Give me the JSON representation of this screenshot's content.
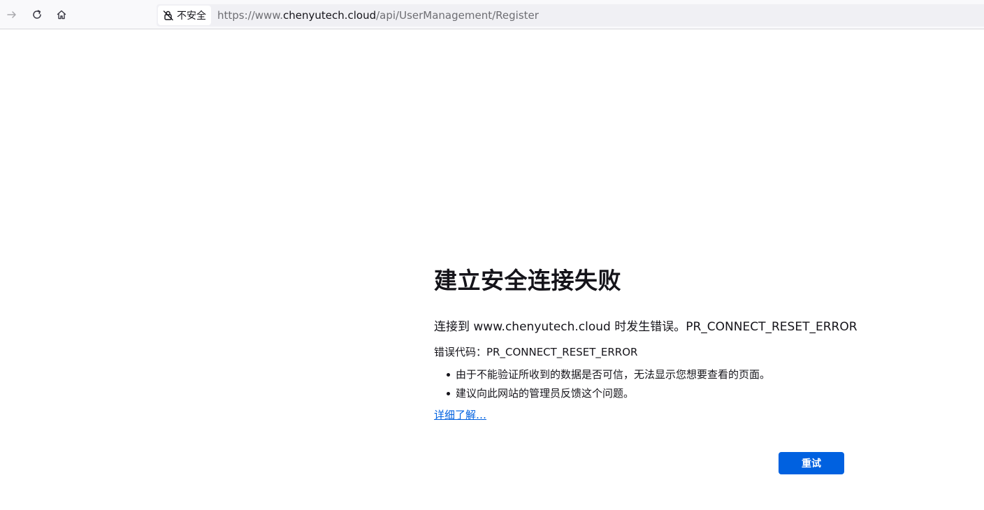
{
  "toolbar": {
    "forward_icon": "arrow-right-icon",
    "reload_icon": "reload-icon",
    "home_icon": "home-icon",
    "security_icon": "insecure-lock-icon",
    "security_label": "不安全",
    "url_scheme": "https://",
    "url_sub": "www.",
    "url_host": "chenyutech.cloud",
    "url_path": "/api/UserManagement/Register"
  },
  "error": {
    "title": "建立安全连接失败",
    "short_desc": "连接到 www.chenyutech.cloud 时发生错误。PR_CONNECT_RESET_ERROR",
    "error_code": "错误代码：PR_CONNECT_RESET_ERROR",
    "bullets": [
      "由于不能验证所收到的数据是否可信，无法显示您想要查看的页面。",
      "建议向此网站的管理员反馈这个问题。"
    ],
    "learn_more": "详细了解…",
    "try_again": "重试"
  },
  "colors": {
    "accent": "#0061e0",
    "text": "#15141a",
    "toolbar_bg": "#f9f9fb",
    "urlbar_bg": "#f0f0f4"
  }
}
